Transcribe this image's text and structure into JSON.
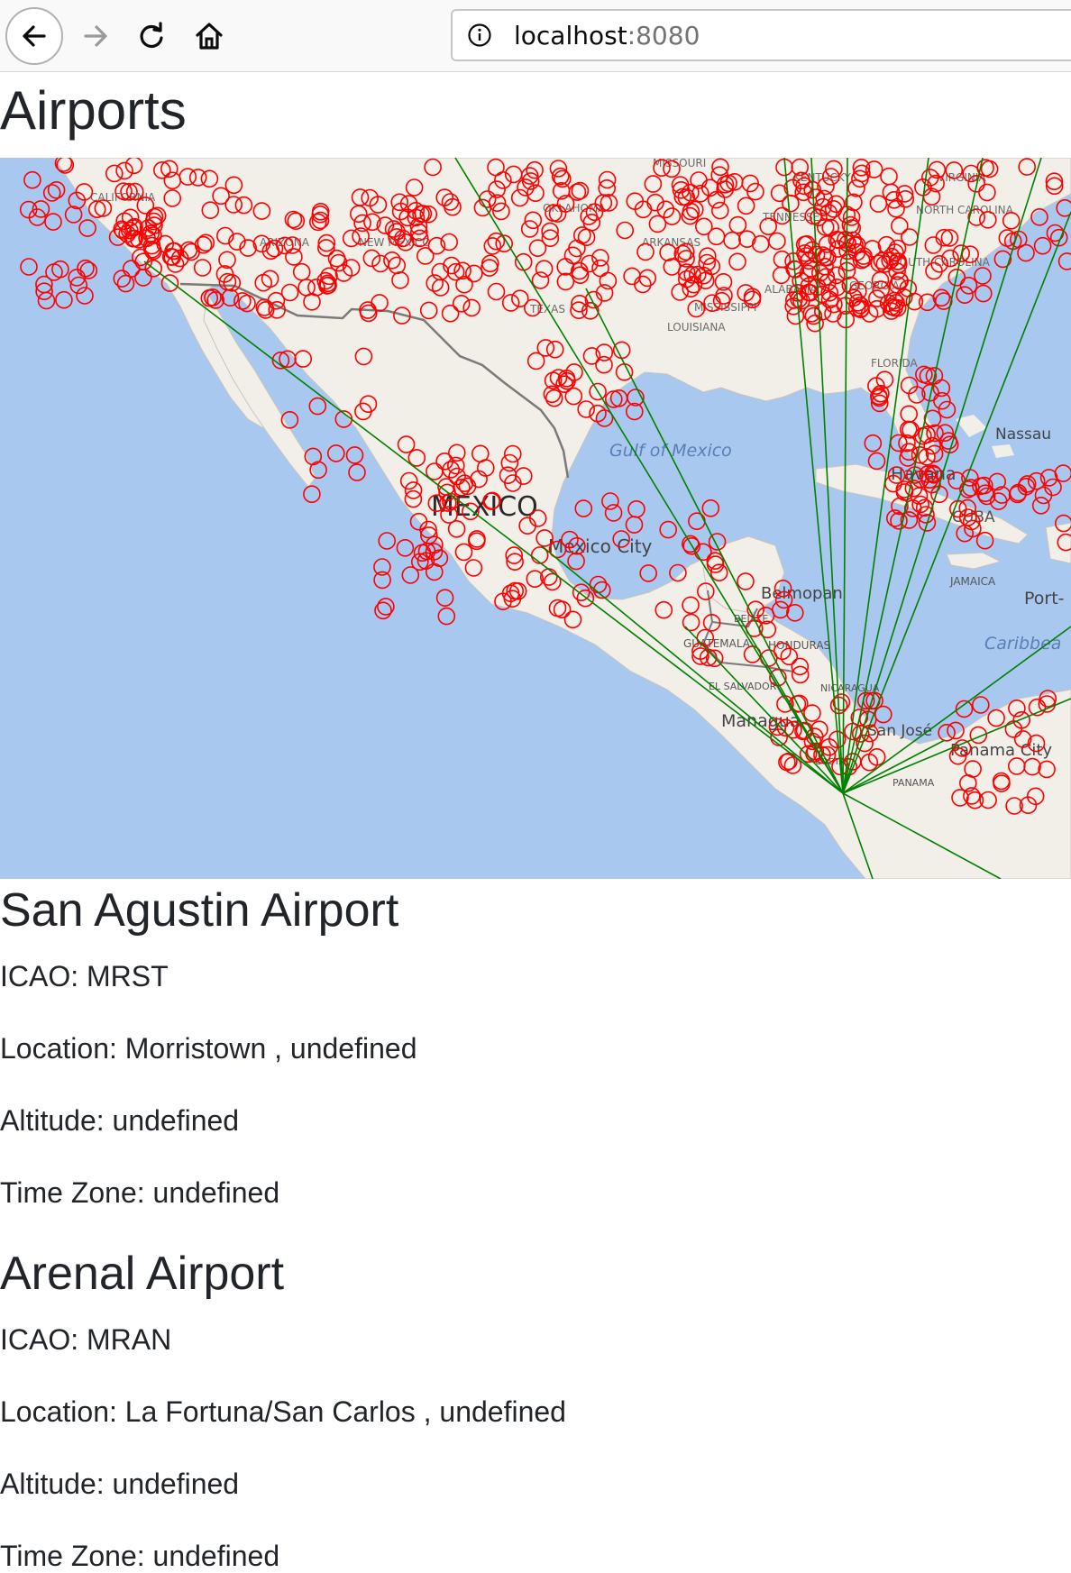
{
  "browser": {
    "url_host": "localhost",
    "url_port": ":8080"
  },
  "page": {
    "title": "Airports"
  },
  "map": {
    "colors": {
      "water": "#a9c8f0",
      "land": "#f2efe9",
      "airport_marker": "#ff0000",
      "route": "#008000",
      "border": "#7a7a7a"
    },
    "labels": {
      "missouri": "MISSOURI",
      "kentucky": "KENTUCKY",
      "virginia": "VIRGINIA",
      "california": "CALIFORNIA",
      "oklahoma": "OKLAHOMA",
      "tennessee": "TENNESSEE",
      "north_carolina": "NORTH CAROLINA",
      "arizona": "ARIZONA",
      "new_mexico": "NEW MEXICO",
      "arkansas": "ARKANSAS",
      "south_carolina": "SOUTH CAROLINA",
      "alabama": "ALABAMA",
      "georgia": "GEORGIA",
      "texas": "TEXAS",
      "mississippi": "MISSISSIPPI",
      "louisiana": "LOUISIANA",
      "florida": "FLORIDA",
      "gulf_of_mexico": "Gulf of Mexico",
      "nassau": "Nassau",
      "havana": "Havana",
      "mexico": "MEXICO",
      "cuba": "CUBA",
      "mexico_city": "Mexico City",
      "jamaica": "JAMAICA",
      "port": "Port-",
      "belmopan": "Belmopan",
      "belize": "BELIZE",
      "guatemala": "GUATEMALA",
      "honduras": "HONDURAS",
      "caribbean": "Caribbea",
      "el_salvador": "EL SALVADOR",
      "nicaragua": "NICARAGUA",
      "managua": "Managua",
      "san_jose": "San José",
      "panama_city": "Panama City",
      "costa_rica": "COSTA",
      "panama": "PANAMA"
    }
  },
  "airports": [
    {
      "name": "San Agustin Airport",
      "icao": "ICAO: MRST",
      "location": "Location: Morristown , undefined",
      "altitude": "Altitude: undefined",
      "timezone": "Time Zone: undefined"
    },
    {
      "name": "Arenal Airport",
      "icao": "ICAO: MRAN",
      "location": "Location: La Fortuna/San Carlos , undefined",
      "altitude": "Altitude: undefined",
      "timezone": "Time Zone: undefined"
    }
  ]
}
